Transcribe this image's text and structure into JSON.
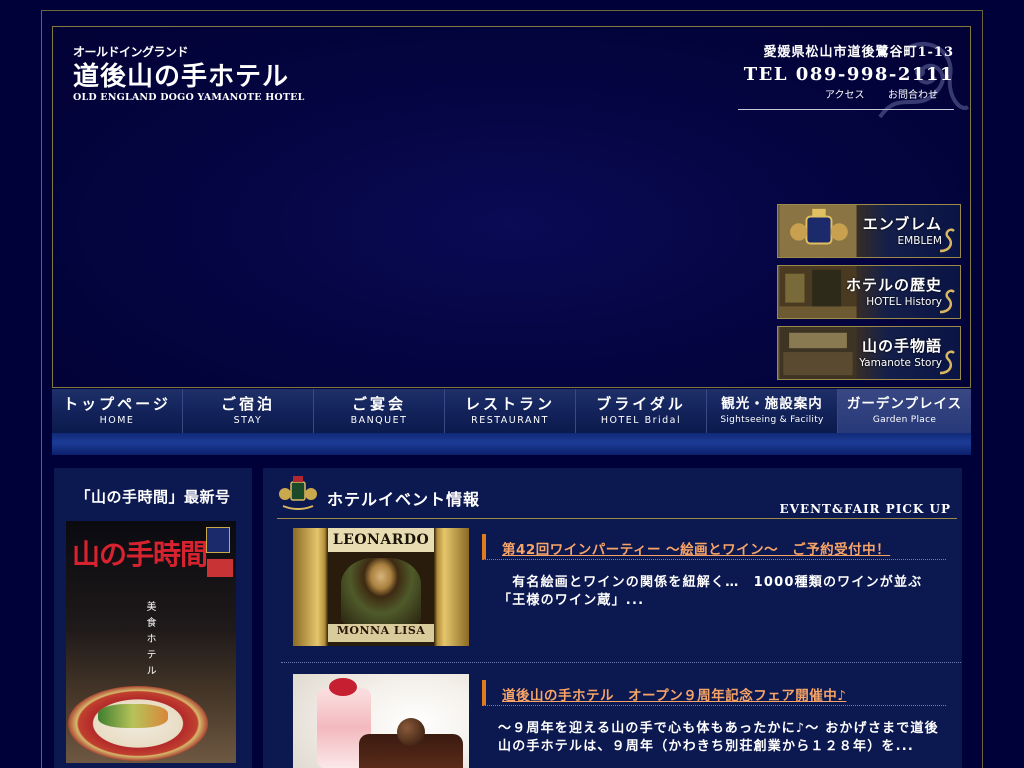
{
  "header": {
    "logo_sub": "オールドイングランド",
    "logo_main": "道後山の手ホテル",
    "logo_en": "OLD ENGLAND DOGO YAMANOTE HOTEL",
    "address": "愛媛県松山市道後鷺谷町1-13",
    "tel": "TEL 089-998-2111",
    "links": {
      "access": "アクセス",
      "contact": "お問合わせ"
    }
  },
  "banners": [
    {
      "jp": "エンブレム",
      "en": "EMBLEM"
    },
    {
      "jp": "ホテルの歴史",
      "en": "HOTEL History"
    },
    {
      "jp": "山の手物語",
      "en": "Yamanote Story"
    }
  ],
  "nav": [
    {
      "jp": "トップページ",
      "en": "HOME"
    },
    {
      "jp": "ご宿泊",
      "en": "STAY"
    },
    {
      "jp": "ご宴会",
      "en": "BANQUET"
    },
    {
      "jp": "レストラン",
      "en": "RESTAURANT"
    },
    {
      "jp": "ブライダル",
      "en": "HOTEL Bridal"
    },
    {
      "jp": "観光・施設案内",
      "en": "Sightseeing & Facility"
    },
    {
      "jp": "ガーデンプレイス",
      "en": "Garden Place"
    }
  ],
  "sidebar": {
    "title": "「山の手時間」最新号",
    "magazine_title": "山の手時間",
    "magazine_vertical": "美食ホテル"
  },
  "events": {
    "title": "ホテルイベント情報",
    "pickup": "EVENT&FAIR PICK UP",
    "items": [
      {
        "title": "第42回ワインパーティー 〜絵画とワイン〜　ご予約受付中！",
        "desc": "　有名絵画とワインの関係を紐解く…　1000種類のワインが並ぶ「王様のワイン蔵」...",
        "label_top": "LEONARDO",
        "label_bottom": "MONNA LISA"
      },
      {
        "title": "道後山の手ホテル　オープン９周年記念フェア開催中♪",
        "desc": "〜９周年を迎える山の手で心も体もあったかに♪〜 おかげさまで道後山の手ホテルは、９周年（かわきち別荘創業から１２８年）を..."
      }
    ]
  },
  "colors": {
    "background": "#01013a",
    "accent_gold": "#9c8b48",
    "link_orange": "#f7a466",
    "title_bar": "#e07a1f"
  }
}
